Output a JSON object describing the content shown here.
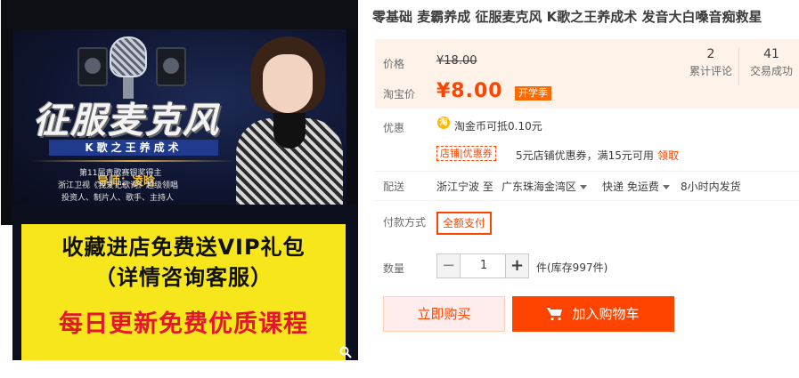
{
  "product": {
    "title": "零基础 麦霸养成 征服麦克风 K歌之王养成术 发音大白嗓音痴救星"
  },
  "image": {
    "poster_title": "征服麦克风",
    "poster_subtitle": "K歌之王养成术",
    "mentor": "导师：凌晗",
    "credentials": [
      "第11届青歌赛银奖得主",
      "浙江卫视《我爱记歌词》超级领唱",
      "投资人、制片人、歌手、主持人"
    ],
    "promo_line1": "收藏进店免费送VIP礼包",
    "promo_line2": "（详情咨询客服）",
    "promo_line3": "每日更新免费优质课程",
    "zoom_icon": "magnifier-icon"
  },
  "price": {
    "original_label": "价格",
    "original_value": "¥18.00",
    "taobao_label": "淘宝价",
    "taobao_value": "¥8.00",
    "season_tag": "开学季"
  },
  "stats": {
    "reviews_count": "2",
    "reviews_label": "累计评论",
    "sales_count": "41",
    "sales_label": "交易成功"
  },
  "discount": {
    "label": "优惠",
    "coin_icon": "taobao-coin-icon",
    "coin_glyph": "淘",
    "coin_text": "淘金币可抵0.10元",
    "coupon_tag": "店铺|优惠券",
    "coupon_text": "5元店铺优惠券，满15元可用",
    "coupon_link": "领取"
  },
  "shipping": {
    "label": "配送",
    "from": "浙江宁波 至",
    "to": "广东珠海金湾区",
    "method": "快递 免运费",
    "dispatch": "8小时内发货"
  },
  "payment": {
    "label": "付款方式",
    "option": "全额支付"
  },
  "quantity": {
    "label": "数量",
    "minus": "−",
    "value": "1",
    "plus": "+",
    "stock": "件(库存997件)"
  },
  "actions": {
    "buy_now": "立即购买",
    "add_to_cart": "加入购物车",
    "cart_icon": "shopping-cart-icon"
  },
  "colors": {
    "accent": "#ff4400",
    "price_bg": "#fff2e8",
    "promo_yellow": "#f7e61b",
    "promo_red": "#e5162c"
  }
}
